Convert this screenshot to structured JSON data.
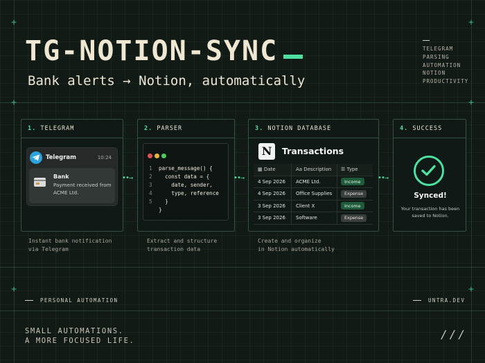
{
  "header": {
    "title": "TG-NOTION-SYNC",
    "subtitle": "Bank alerts → Notion, automatically",
    "tags": [
      "TELEGRAM",
      "PARSING",
      "AUTOMATION",
      "NOTION",
      "PRODUCTIVITY"
    ]
  },
  "stages": [
    {
      "num": "1.",
      "label": "TELEGRAM",
      "caption": "Instant bank notification\nvia Telegram"
    },
    {
      "num": "2.",
      "label": "PARSER",
      "caption": "Extract and structure\ntransaction data"
    },
    {
      "num": "3.",
      "label": "NOTION DATABASE",
      "caption": "Create and organize\nin Notion automatically"
    },
    {
      "num": "4.",
      "label": "SUCCESS"
    }
  ],
  "telegram": {
    "app_name": "Telegram",
    "time": "10:24",
    "sender": "Bank",
    "message": "Payment received from ACME Ltd."
  },
  "parser": {
    "code_lines": [
      {
        "n": "1",
        "text": "parse_message() {"
      },
      {
        "n": "2",
        "text": "  const data = {"
      },
      {
        "n": "3",
        "text": "    date, sender,"
      },
      {
        "n": "4",
        "text": "    type, reference"
      },
      {
        "n": "5",
        "text": "  }"
      },
      {
        "n": "",
        "text": "}"
      }
    ]
  },
  "notion": {
    "db_title": "Transactions",
    "columns": [
      "Date",
      "Aa Description",
      "Type"
    ],
    "rows": [
      {
        "date": "4 Sep 2026",
        "desc": "ACME Ltd.",
        "type": "Income"
      },
      {
        "date": "4 Sep 2026",
        "desc": "Office Supplies",
        "type": "Expense"
      },
      {
        "date": "3 Sep 2026",
        "desc": "Client X",
        "type": "Income"
      },
      {
        "date": "3 Sep 2026",
        "desc": "Software",
        "type": "Expense"
      }
    ]
  },
  "success": {
    "title": "Synced!",
    "text": "Your transaction has been saved to Notion."
  },
  "footer": {
    "left": "PERSONAL AUTOMATION",
    "right": "UNTRA.DEV",
    "tagline": "SMALL AUTOMATIONS.\nA MORE FOCUSED LIFE.",
    "mark": "///"
  },
  "colors": {
    "accent": "#4ee0a0",
    "background": "#121a16",
    "telegram": "#2ca3de"
  }
}
